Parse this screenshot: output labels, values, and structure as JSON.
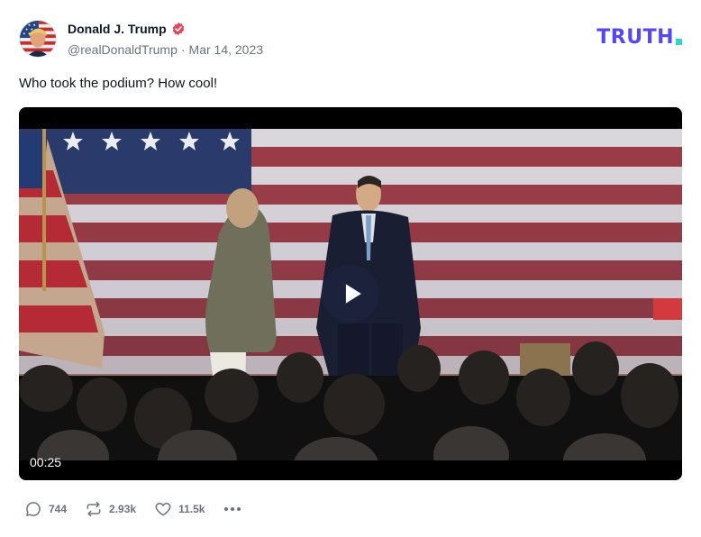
{
  "post": {
    "author": {
      "display_name": "Donald J. Trump",
      "handle": "@realDonaldTrump",
      "date": "Mar 14, 2023",
      "verified": true,
      "avatar_icon": "avatar-flag-portrait"
    },
    "text": "Who took the podium? How cool!",
    "video": {
      "duration": "00:25",
      "play_icon": "play-icon"
    },
    "actions": {
      "replies": "744",
      "retruths": "2.93k",
      "likes": "11.5k",
      "reply_icon": "comment-icon",
      "retruth_icon": "retruth-icon",
      "like_icon": "heart-icon",
      "more_icon": "more-dots-icon"
    }
  },
  "brand": {
    "logo_text": "TRUTH",
    "logo_color": "#5448ee",
    "logo_dot_color": "#31d4c9",
    "verified_color": "#e0475c"
  }
}
